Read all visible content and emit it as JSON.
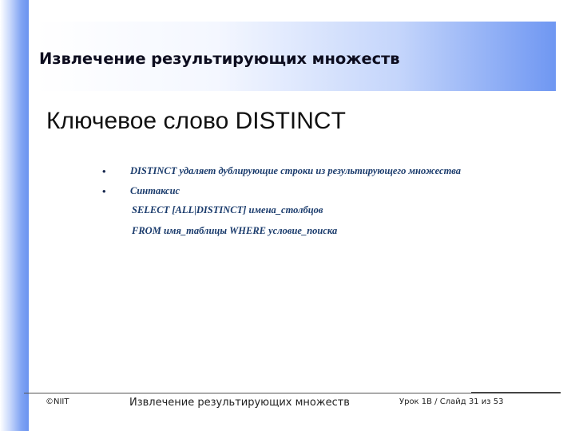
{
  "slide": {
    "title": "Извлечение результирующих множеств",
    "subtitle": "Ключевое слово DISTINCT",
    "bullets": [
      {
        "symbol": "•",
        "text": "DISTINCT удаляет дублирующие строки из результирующего множества"
      },
      {
        "symbol": "•",
        "text": "Синтаксис"
      }
    ],
    "syntax_lines": [
      "SELECT [ALL|DISTINCT] имена_столбцов",
      "FROM имя_таблицы WHERE условие_поиска"
    ]
  },
  "footer": {
    "left": "©NIIT",
    "center": "Извлечение результирующих множеств",
    "right": "Урок 1B / Слайд 31 из 53"
  },
  "colors": {
    "accent_blue": "#6b93f0",
    "body_text": "#1a3b6c"
  }
}
